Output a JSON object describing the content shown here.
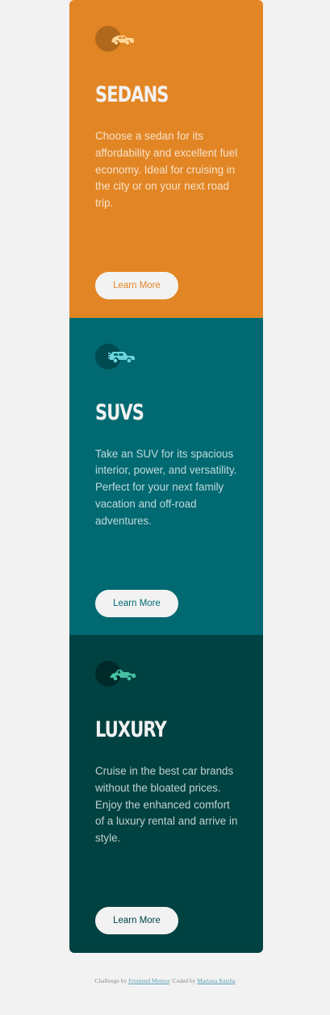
{
  "cards": [
    {
      "title": "SEDANS",
      "icon": "sedan-car-icon",
      "description": "Choose a sedan for its affordability and excellent fuel economy. Ideal for cruising in the city or on your next road trip.",
      "button_label": "Learn More",
      "color": "#e28625"
    },
    {
      "title": "SUVS",
      "icon": "suv-car-icon",
      "description": "Take an SUV for its spacious interior, power, and versatility. Perfect for your next family vacation and off-road adventures.",
      "button_label": "Learn More",
      "color": "#006971"
    },
    {
      "title": "LUXURY",
      "icon": "luxury-car-icon",
      "description": "Cruise in the best car brands without the bloated prices. Enjoy the enhanced comfort of a luxury rental and arrive in style.",
      "button_label": "Learn More",
      "color": "#004241"
    }
  ],
  "footer": {
    "challenge_prefix": "Challenge by",
    "challenge_link": "Frontend Mentor",
    "coded_prefix": ". Coded by",
    "coded_link": "Mariana Raisha"
  }
}
